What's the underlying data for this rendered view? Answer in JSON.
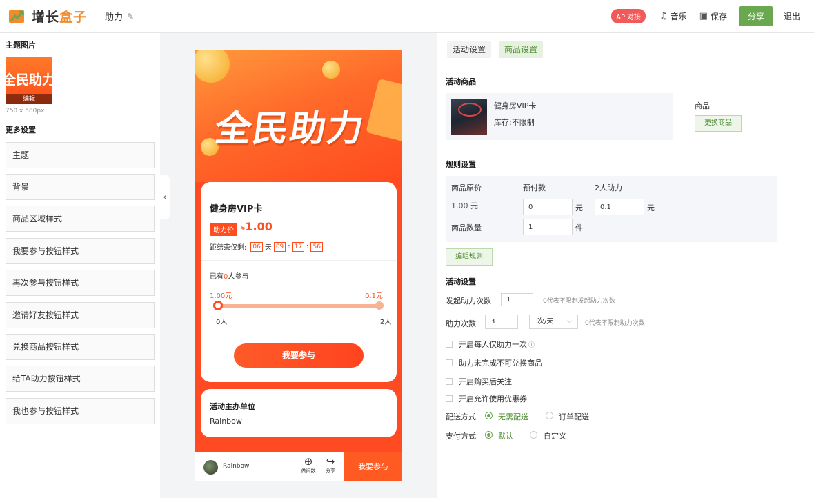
{
  "header": {
    "logo_text_1": "增长",
    "logo_text_2": "盒子",
    "page_name": "助力",
    "api_badge": "API对接",
    "music_label": "音乐",
    "save_label": "保存",
    "share_label": "分享",
    "logout_label": "退出"
  },
  "left": {
    "theme_image_title": "主题图片",
    "theme_thumb_text": "全民助力",
    "theme_thumb_edit": "编辑",
    "theme_size": "750 x 580px",
    "more_settings_title": "更多设置",
    "menu": [
      {
        "label": "主题"
      },
      {
        "label": "背景"
      },
      {
        "label": "商品区域样式"
      },
      {
        "label": "我要参与按钮样式"
      },
      {
        "label": "再次参与按钮样式"
      },
      {
        "label": "邀请好友按钮样式"
      },
      {
        "label": "兑换商品按钮样式"
      },
      {
        "label": "给TA助力按钮样式"
      },
      {
        "label": "我也参与按钮样式"
      }
    ]
  },
  "preview": {
    "banner_title": "全民助力",
    "product_name": "健身房VIP卡",
    "price_tag": "助力价",
    "price_symbol": "¥",
    "price": "1.00",
    "countdown_label": "距结束仅剩:",
    "cd_days": "06",
    "cd_day_unit": "天",
    "cd_hours": "09",
    "cd_minutes": "17",
    "cd_seconds": "56",
    "cd_sep": ":",
    "joined_prefix": "已有",
    "joined_count": "0",
    "joined_suffix": "人参与",
    "progress_left": "1.00元",
    "progress_right": "0.1元",
    "progress_fraction": 0,
    "people_start": "0人",
    "people_end": "2人",
    "join_button": "我要参与",
    "org_title": "活动主办单位",
    "org_name": "Rainbow",
    "bar_user": "Rainbow",
    "bar_icon1": "做间数",
    "bar_icon2": "分享",
    "bar_join": "我要参与"
  },
  "right": {
    "tab_activity": "活动设置",
    "tab_goods": "商品设置",
    "goods_title": "活动商品",
    "goods_name": "健身房VIP卡",
    "goods_stock": "库存:不限制",
    "goods_label": "商品",
    "change_goods": "更换商品",
    "rule_title": "规则设置",
    "col_original": "商品原价",
    "col_prepay": "预付款",
    "col_help": "2人助力",
    "original_price": "1.00 元",
    "prepay_value": "0",
    "help_value": "0.1",
    "unit_yuan": "元",
    "qty_label": "商品数量",
    "qty_value": "1",
    "unit_piece": "件",
    "edit_rule": "编辑规则",
    "activity_title": "活动设置",
    "launch_label": "发起助力次数",
    "launch_value": "1",
    "launch_hint": "0代表不限制发起助力次数",
    "help_times_label": "助力次数",
    "help_times_value": "3",
    "help_period": "次/天",
    "help_hint": "0代表不限制助力次数",
    "opt_once": "开启每人仅助力一次",
    "opt_incomplete": "助力未完成不可兑换商品",
    "opt_follow": "开启购买后关注",
    "opt_coupon": "开启允许使用优惠券",
    "delivery_label": "配送方式",
    "delivery_none": "无需配送",
    "delivery_order": "订单配送",
    "pay_label": "支付方式",
    "pay_default": "默认",
    "pay_custom": "自定义"
  }
}
